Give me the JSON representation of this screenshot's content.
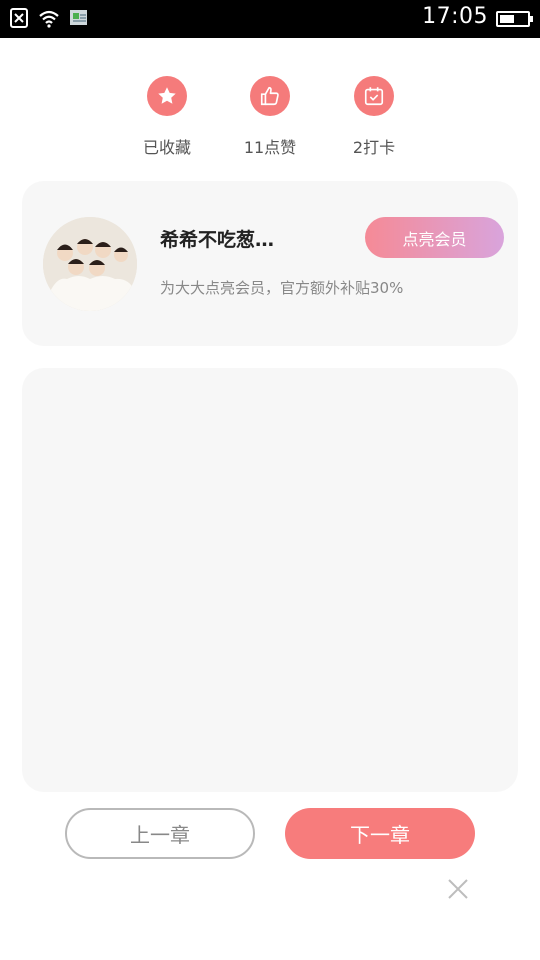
{
  "status_bar": {
    "time": "17:05",
    "battery_level": 0.55,
    "icons": [
      "sim-off-icon",
      "wifi-icon",
      "download-notification-icon",
      "battery-icon"
    ]
  },
  "actions": [
    {
      "label": "已收藏",
      "icon": "star-icon"
    },
    {
      "label": "11点赞",
      "icon": "thumbs-up-icon"
    },
    {
      "label": "2打卡",
      "icon": "calendar-check-icon"
    }
  ],
  "author": {
    "name": "希希不吃葱…",
    "vip_button": "点亮会员",
    "description": "为大大点亮会员，官方额外补贴30%"
  },
  "navigation": {
    "prev_label": "上一章",
    "next_label": "下一章"
  },
  "colors": {
    "accent": "#f77c7c",
    "vip_gradient_start": "#f58a96",
    "vip_gradient_end": "#d9a4dc",
    "card_bg": "#f7f7f7"
  }
}
